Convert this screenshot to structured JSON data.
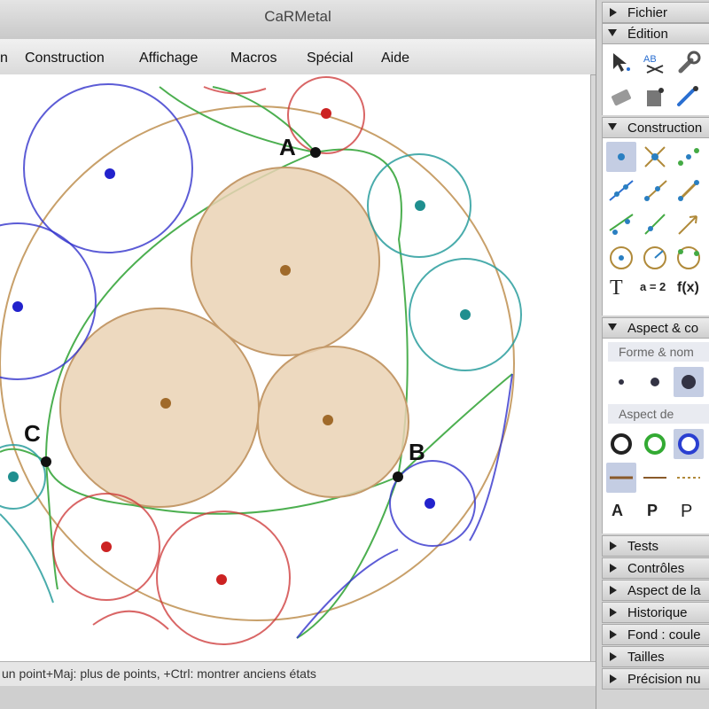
{
  "app": {
    "title": "CaRMetal"
  },
  "menu": [
    "n",
    "Construction",
    "Affichage",
    "Macros",
    "Spécial",
    "Aide"
  ],
  "canvas": {
    "points": {
      "A": "A",
      "B": "B",
      "C": "C"
    }
  },
  "status": {
    "text": "un point+Maj: plus de points, +Ctrl: montrer anciens états"
  },
  "palette": {
    "fichier": "Fichier",
    "edition": "Édition",
    "construction": "Construction",
    "aspect": "Aspect & co",
    "forme": "Forme & nom",
    "aspect_de": "Aspect de",
    "tests": "Tests",
    "controles": "Contrôles",
    "aspect_de_la": "Aspect de la",
    "historique": "Historique",
    "fond": "Fond : coule",
    "tailles": "Tailles",
    "precision": "Précision nu",
    "text_tools": {
      "t": "T",
      "formula": "a = 2",
      "fx": "f(x)"
    },
    "label_tools": [
      "A",
      "P",
      "P"
    ]
  },
  "colors": {
    "outer_circle": "#c8a06a",
    "green": "#4caf50",
    "fill": "#ead2b4",
    "fill_stroke": "#c49a6a",
    "blue": "#3333cc",
    "teal": "#2a9d9d",
    "red": "#cc3333"
  }
}
